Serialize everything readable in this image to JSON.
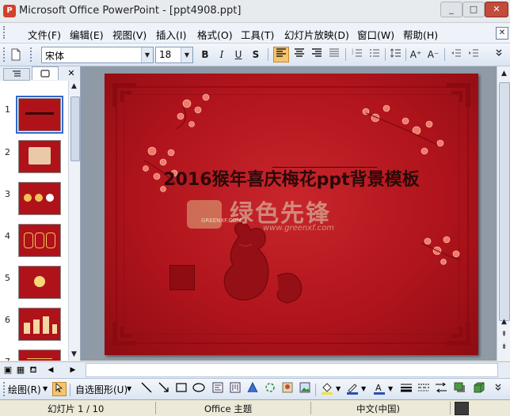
{
  "window": {
    "title": "Microsoft Office PowerPoint - [ppt4908.ppt]",
    "minimize": "_",
    "maximize": "□",
    "close": "✕"
  },
  "menu": {
    "items": [
      "文件(F)",
      "编辑(E)",
      "视图(V)",
      "插入(I)",
      "格式(O)",
      "工具(T)",
      "幻灯片放映(D)",
      "窗口(W)",
      "帮助(H)"
    ],
    "close_doc": "✕"
  },
  "toolbar": {
    "font": "宋体",
    "size": "18",
    "bold": "B",
    "italic": "I",
    "underline": "U",
    "shadow": "S",
    "increase_font": "A⁺",
    "decrease_font": "A⁻"
  },
  "left_panel": {
    "close": "✕",
    "slide_numbers": [
      "1",
      "2",
      "3",
      "4",
      "5",
      "6",
      "7"
    ],
    "selected": 1
  },
  "slide": {
    "title": "2016猴年喜庆梅花ppt背景模板",
    "watermark": "绿色先锋",
    "watermark_url": "www.greenxf.com",
    "watermark_logo": "GREENXF.COM"
  },
  "drawing_toolbar": {
    "draw": "绘图(R)",
    "autoshapes": "自选图形(U)"
  },
  "status": {
    "slide": "幻灯片 1 / 10",
    "theme": "Office 主题",
    "language": "中文(中国)"
  },
  "colors": {
    "slide_red": "#b1141c",
    "selection": "#3366cc"
  }
}
